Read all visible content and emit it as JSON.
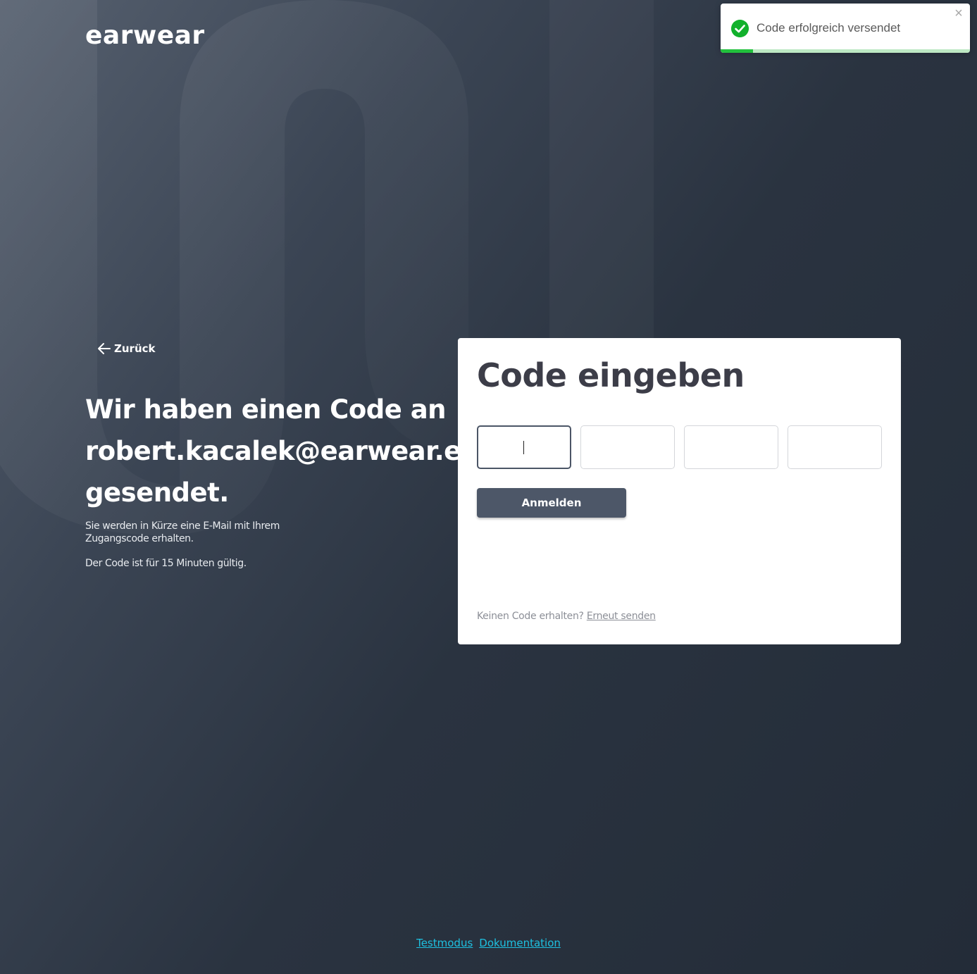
{
  "brand": {
    "logo_text": "earwear"
  },
  "toast": {
    "message": "Code erfolgreich versendet",
    "close_glyph": "×",
    "icon": "check-circle-icon",
    "progress": 0.13,
    "accent_color": "#12b12c"
  },
  "nav": {
    "back_label": "Zurück",
    "back_icon": "arrow-left-icon"
  },
  "intro": {
    "headline": "Wir haben einen Code an robert.kacalek@earwear.eu gesendet.",
    "description": "Sie werden in Kürze eine E-Mail mit Ihrem Zugangscode erhalten.",
    "validity": "Der Code ist für 15 Minuten gültig."
  },
  "form": {
    "title": "Code eingeben",
    "code_digits": [
      "",
      "",
      "",
      ""
    ],
    "submit_label": "Anmelden",
    "resend_prompt": "Keinen Code erhalten?",
    "resend_link": "Erneut senden"
  },
  "footer": {
    "links": [
      "Testmodus",
      "Dokumentation"
    ],
    "link_color": "#1ec0e0"
  }
}
